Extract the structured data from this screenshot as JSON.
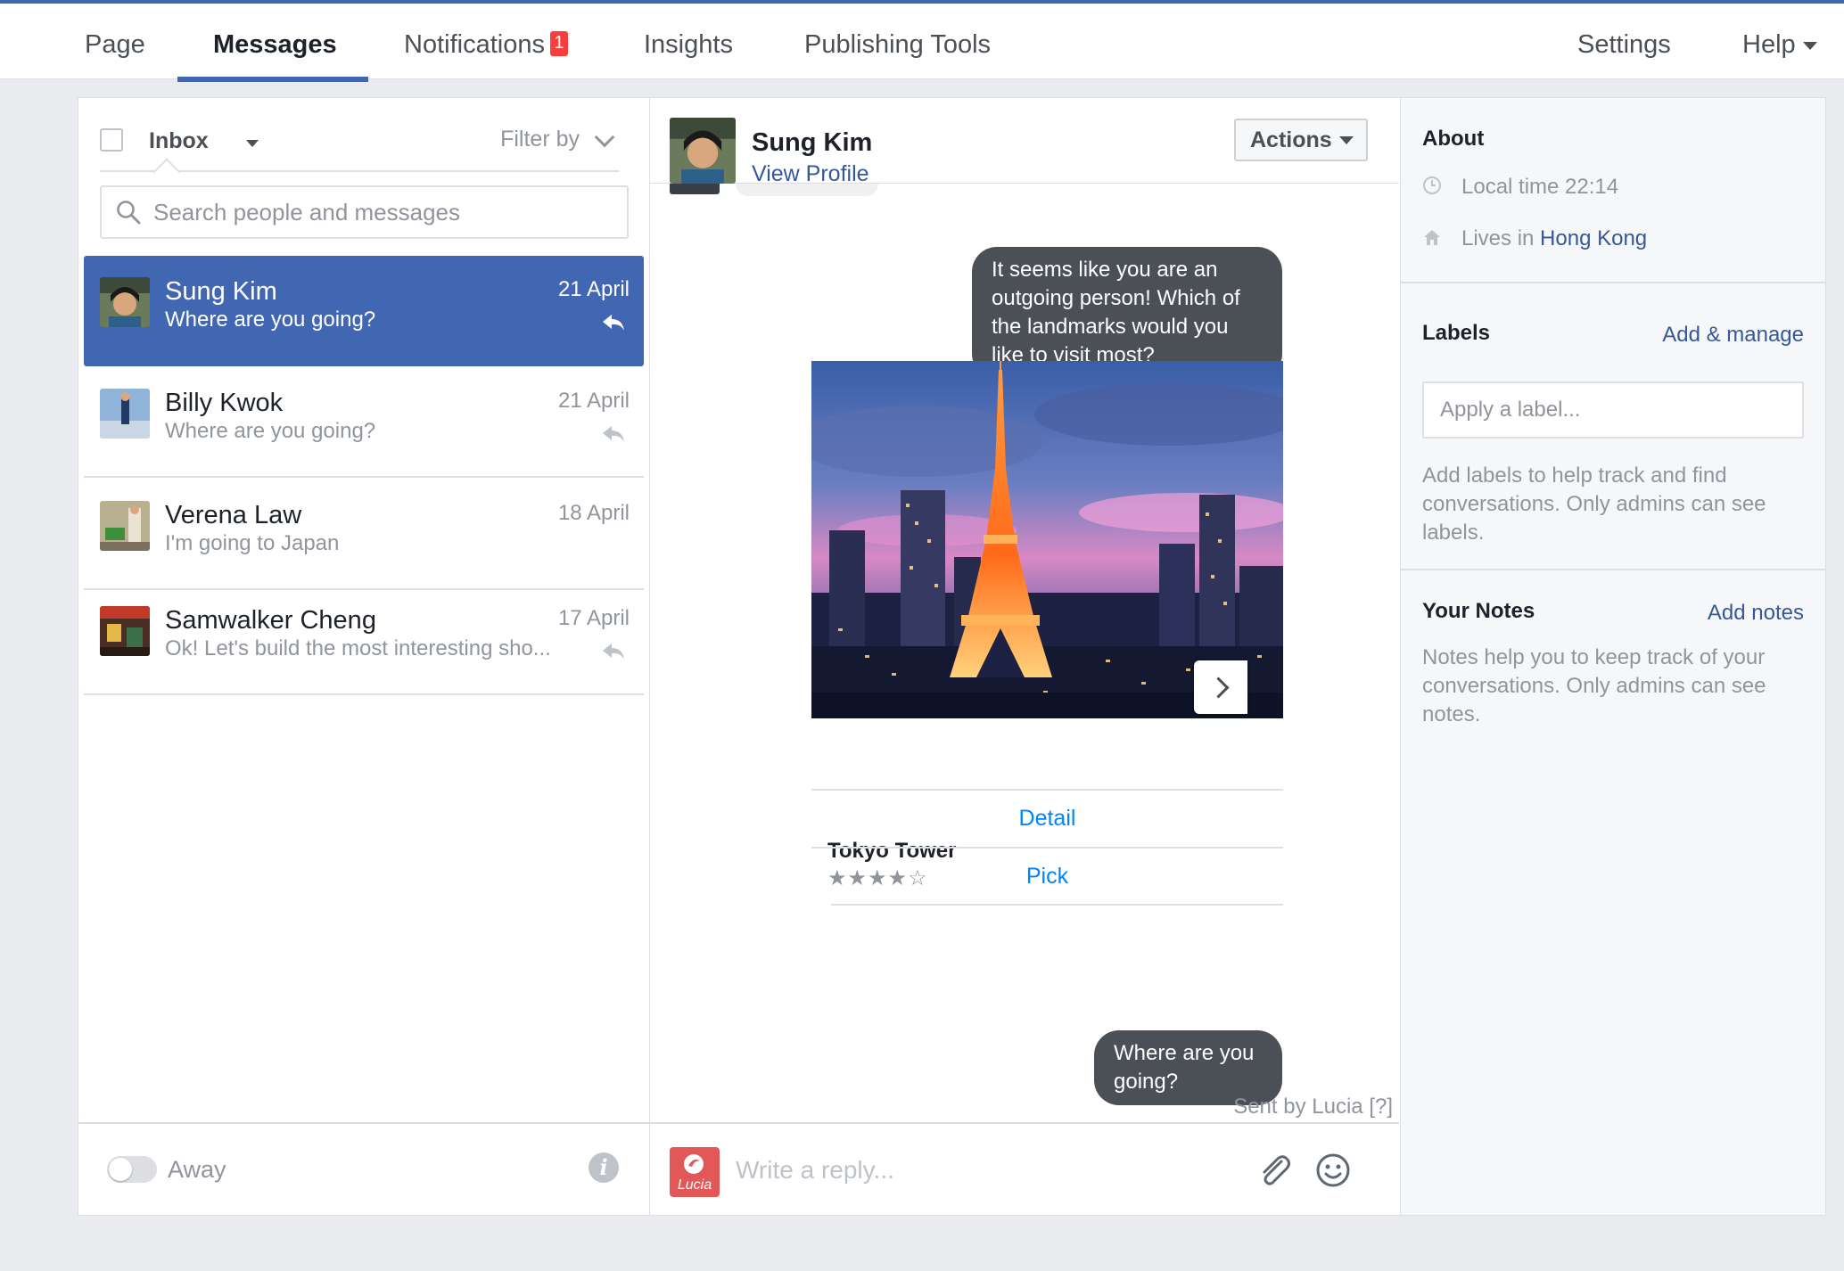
{
  "nav": {
    "tabs": [
      {
        "label": "Page"
      },
      {
        "label": "Messages"
      },
      {
        "label": "Notifications",
        "badge": "1"
      },
      {
        "label": "Insights"
      },
      {
        "label": "Publishing Tools"
      }
    ],
    "settings": "Settings",
    "help": "Help",
    "active_tab": "Messages"
  },
  "inbox": {
    "title": "Inbox",
    "filter_label": "Filter by",
    "search_placeholder": "Search people and messages",
    "conversations": [
      {
        "name": "Sung Kim",
        "snippet": "Where are you going?",
        "date": "21 April",
        "selected": true
      },
      {
        "name": "Billy Kwok",
        "snippet": "Where are you going?",
        "date": "21 April"
      },
      {
        "name": "Verena Law",
        "snippet": "I'm going to Japan",
        "date": "18 April"
      },
      {
        "name": "Samwalker Cheng",
        "snippet": "Ok! Let's build the most interesting sho...",
        "date": "17 April"
      }
    ],
    "away_label": "Away"
  },
  "thread": {
    "name": "Sung Kim",
    "view_profile": "View Profile",
    "actions_label": "Actions",
    "message_outgoing": "It seems like you are an outgoing person! Which of the landmarks would you like to visit most?",
    "card": {
      "title": "Tokyo Tower",
      "rating": "★★★★☆",
      "buttons": [
        "Detail",
        "Pick"
      ]
    },
    "last_message": "Where are you going?",
    "sent_by": "Sent by Lucia",
    "sent_by_help": "[?]",
    "reply_placeholder": "Write a reply...",
    "brand_name": "Lucia"
  },
  "about": {
    "title": "About",
    "local_time": "Local time 22:14",
    "lives_in_prefix": "Lives in",
    "lives_in_place": "Hong Kong"
  },
  "labels": {
    "title": "Labels",
    "action": "Add & manage",
    "placeholder": "Apply a label...",
    "help": "Add labels to help track and find conversations. Only admins can see labels."
  },
  "notes": {
    "title": "Your Notes",
    "action": "Add notes",
    "help": "Notes help you to keep track of your conversations. Only admins can see notes."
  },
  "colors": {
    "brand_blue": "#4267b2",
    "link_blue": "#365899",
    "messenger_blue": "#0084ff",
    "badge_red": "#fa3e3e",
    "bubble_dark": "#4b4f56"
  }
}
